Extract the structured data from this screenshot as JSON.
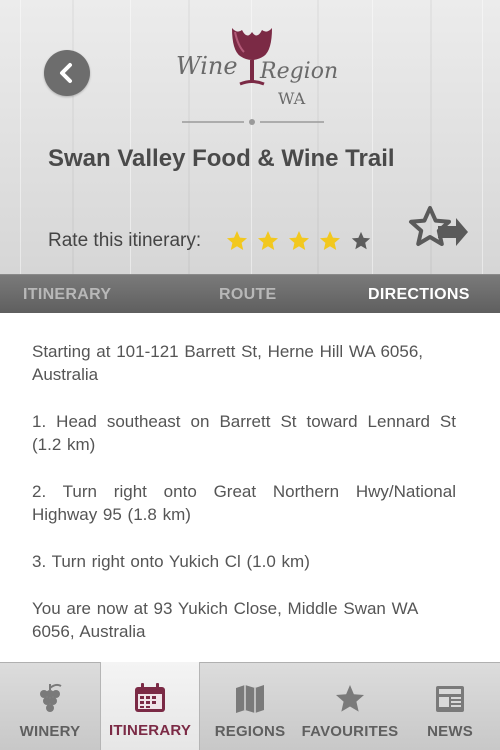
{
  "header": {
    "logo": {
      "line1": "Wine",
      "line2": "Regions",
      "line3": "WA"
    },
    "title": "Swan Valley Food & Wine Trail",
    "rate_label": "Rate this itinerary:",
    "rating": 4,
    "rating_max": 5,
    "colors": {
      "star_filled": "#f2c81e",
      "star_empty": "#5c5c5c",
      "brand": "#7b2a45"
    }
  },
  "tabs": [
    {
      "label": "ITINERARY",
      "active": false
    },
    {
      "label": "ROUTE",
      "active": false
    },
    {
      "label": "DIRECTIONS",
      "active": true
    }
  ],
  "directions": {
    "start": "Starting at 101-121 Barrett St, Herne Hill WA 6056, Australia",
    "steps": [
      "1. Head  southeast  on  Barrett St  toward  Lennard St  (1.2 km)",
      "2. Turn  right  onto  Great Northern Hwy/National Highway 95  (1.8 km)",
      "3. Turn  right  onto  Yukich Cl  (1.0 km)"
    ],
    "end": "You are now at 93 Yukich Close, Middle Swan WA 6056, Australia"
  },
  "bottom_nav": [
    {
      "label": "WINERY",
      "icon": "grapes-icon",
      "active": false
    },
    {
      "label": "ITINERARY",
      "icon": "calendar-icon",
      "active": true
    },
    {
      "label": "REGIONS",
      "icon": "map-icon",
      "active": false
    },
    {
      "label": "FAVOURITES",
      "icon": "star-icon",
      "active": false
    },
    {
      "label": "NEWS",
      "icon": "newspaper-icon",
      "active": false
    }
  ]
}
